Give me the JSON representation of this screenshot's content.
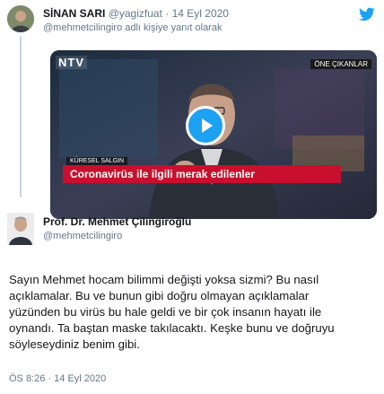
{
  "reply_tweet": {
    "author_name": "SİNAN SARI",
    "handle": "@yagizfuat",
    "separator": "·",
    "date": "14 Eyl 2020",
    "reply_to": "@mehmetcilingiro adlı kişiye yanıt olarak"
  },
  "video": {
    "channel_logo": "NTV",
    "corner_badge": "ÖNE ÇIKANLAR",
    "segment_label": "KÜRESEL SALGIN",
    "headline": "Coronavirüs ile ilgili merak edilenler",
    "play_icon": "play-icon"
  },
  "main_tweet": {
    "author_name": "Prof. Dr. Mehmet Çilingiroğlu",
    "handle": "@mehmetcilingiro",
    "text_lines": [
      "Sayın Mehmet hocam bilimmi değişti yoksa sizmi? Bu nasıl",
      "açıklamalar. Bu ve bunun gibi doğru olmayan açıklamalar",
      "yüzünden bu virüs bu hale geldi ve bir çok insanın hayatı ile",
      "oynandı. Ta baştan maske takılacaktı. Keşke bunu ve doğruyu",
      "söyleseydiniz benim gibi."
    ],
    "time": "ÖS 8:26",
    "separator": "·",
    "date": "14 Eyl 2020"
  },
  "colors": {
    "twitter_blue": "#1da1f2",
    "red_banner": "#c8102e",
    "text_primary": "#14171a",
    "text_secondary": "#657786"
  },
  "icons": [
    "twitter-bird-icon",
    "play-icon"
  ]
}
